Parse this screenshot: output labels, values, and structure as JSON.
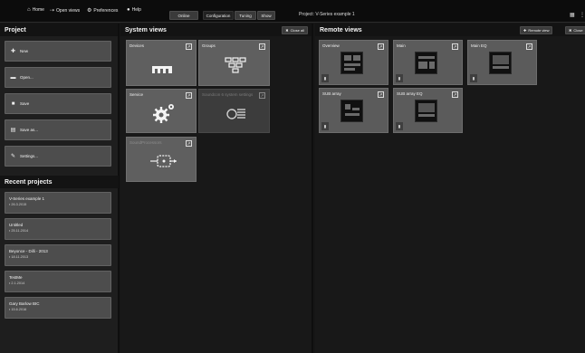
{
  "menu": {
    "home": "Home",
    "open_views": "Open views",
    "preferences": "Preferences",
    "help": "Help",
    "online": "Online",
    "tabs": [
      "Configuration",
      "Tuning",
      "Show"
    ],
    "project_label": "Project: V-Series example 1"
  },
  "project": {
    "heading": "Project",
    "actions": [
      "New",
      "Open...",
      "Save",
      "Save as...",
      "Settings..."
    ]
  },
  "recent": {
    "heading": "Recent projects",
    "items": [
      {
        "name": "V-Series example 1",
        "date": "26.3.2015"
      },
      {
        "name": "Untitled",
        "date": "25.11.2014"
      },
      {
        "name": "Beyonce - Dilli - 2013",
        "date": "18.11.2013"
      },
      {
        "name": "TestMe",
        "date": "2.1.2014"
      },
      {
        "name": "Gary Barlow BIC",
        "date": "15.6.2016"
      }
    ]
  },
  "system": {
    "heading": "System views",
    "close_all": "Close all",
    "tiles": [
      {
        "label": "Devices",
        "icon": "devices-icon"
      },
      {
        "label": "Groups",
        "icon": "groups-icon"
      },
      {
        "label": "Service",
        "icon": "gears-icon"
      },
      {
        "label": "Soundcon 6 system settings",
        "icon": "sliders-icon"
      },
      {
        "label": "SoundProcessors",
        "icon": "processor-icon"
      }
    ]
  },
  "remote": {
    "heading": "Remote views",
    "remote_view": "Remote view",
    "close_all": "Close",
    "tiles": [
      "Overview",
      "Main",
      "Main EQ",
      "SUB array",
      "SUB array EQ"
    ]
  }
}
